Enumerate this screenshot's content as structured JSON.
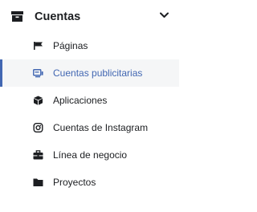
{
  "menu": {
    "title": "Cuentas",
    "title_icon": "briefcase-icon",
    "expand_icon": "chevron-down-icon",
    "accent_color": "#4267b2",
    "items": [
      {
        "label": "Páginas",
        "icon": "flag-icon",
        "selected": false
      },
      {
        "label": "Cuentas publicitarias",
        "icon": "ad-account-icon",
        "selected": true
      },
      {
        "label": "Aplicaciones",
        "icon": "cube-icon",
        "selected": false
      },
      {
        "label": "Cuentas de Instagram",
        "icon": "instagram-icon",
        "selected": false
      },
      {
        "label": "Línea de negocio",
        "icon": "briefcase-icon",
        "selected": false
      },
      {
        "label": "Proyectos",
        "icon": "folder-icon",
        "selected": false
      }
    ]
  }
}
